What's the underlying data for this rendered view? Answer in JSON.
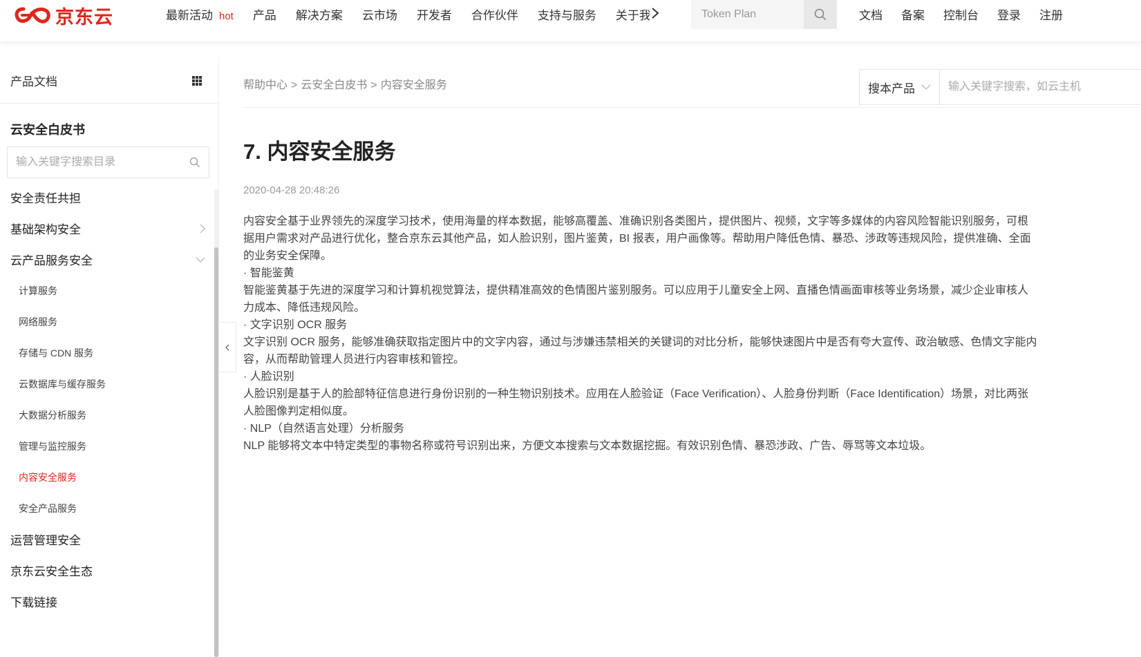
{
  "brand": {
    "logo_text": "京东云",
    "color": "#e1251b"
  },
  "topnav": {
    "items": [
      {
        "label": "最新活动",
        "badge": "hot"
      },
      {
        "label": "产品"
      },
      {
        "label": "解决方案"
      },
      {
        "label": "云市场"
      },
      {
        "label": "开发者"
      },
      {
        "label": "合作伙伴"
      },
      {
        "label": "支持与服务"
      },
      {
        "label": "关于我"
      }
    ],
    "search_placeholder": "Token Plan",
    "right_links": [
      "文档",
      "备案",
      "控制台",
      "登录",
      "注册"
    ]
  },
  "sidebar": {
    "header_title": "产品文档",
    "book_title": "云安全白皮书",
    "search_placeholder": "输入关键字搜索目录",
    "items": [
      {
        "label": "安全责任共担"
      },
      {
        "label": "基础架构安全",
        "state": "collapsed"
      },
      {
        "label": "云产品服务安全",
        "state": "expanded"
      }
    ],
    "sub_items": [
      {
        "label": "计算服务"
      },
      {
        "label": "网络服务"
      },
      {
        "label": "存储与 CDN 服务"
      },
      {
        "label": "云数据库与缓存服务"
      },
      {
        "label": "大数据分析服务"
      },
      {
        "label": "管理与监控服务"
      },
      {
        "label": "内容安全服务",
        "active": true
      },
      {
        "label": "安全产品服务"
      }
    ],
    "items_after": [
      {
        "label": "运营管理安全"
      },
      {
        "label": "京东云安全生态"
      },
      {
        "label": "下载链接"
      }
    ]
  },
  "main": {
    "breadcrumb": [
      "帮助中心",
      "云安全白皮书",
      "内容安全服务"
    ],
    "breadcrumb_sep": ">",
    "product_select": "搜本产品",
    "search_placeholder": "输入关键字搜索，如云主机",
    "title": "7. 内容安全服务",
    "date": "2020-04-28 20:48:26",
    "paragraphs": [
      "内容安全基于业界领先的深度学习技术，使用海量的样本数据，能够高覆盖、准确识别各类图片，提供图片、视频，文字等多媒体的内容风险智能识别服务，可根据用户需求对产品进行优化，整合京东云其他产品，如人脸识别，图片鉴黄，BI 报表，用户画像等。帮助用户降低色情、暴恐、涉政等违规风险，提供准确、全面的业务安全保障。",
      "· 智能鉴黄",
      "智能鉴黄基于先进的深度学习和计算机视觉算法，提供精准高效的色情图片鉴别服务。可以应用于儿童安全上网、直播色情画面审核等业务场景，减少企业审核人力成本、降低违规风险。",
      "· 文字识别 OCR 服务",
      "文字识别 OCR 服务，能够准确获取指定图片中的文字内容，通过与涉嫌违禁相关的关键词的对比分析，能够快速图片中是否有夸大宣传、政治敏感、色情文字能内容，从而帮助管理人员进行内容审核和管控。",
      "· 人脸识别",
      "人脸识别是基于人的脸部特征信息进行身份识别的一种生物识别技术。应用在人脸验证（Face Verification）、人脸身份判断（Face Identification）场景，对比两张人脸图像判定相似度。",
      "· NLP（自然语言处理）分析服务",
      "NLP 能够将文本中特定类型的事物名称或符号识别出来，方便文本搜索与文本数据挖掘。有效识别色情、暴恐涉政、广告、辱骂等文本垃圾。"
    ]
  }
}
